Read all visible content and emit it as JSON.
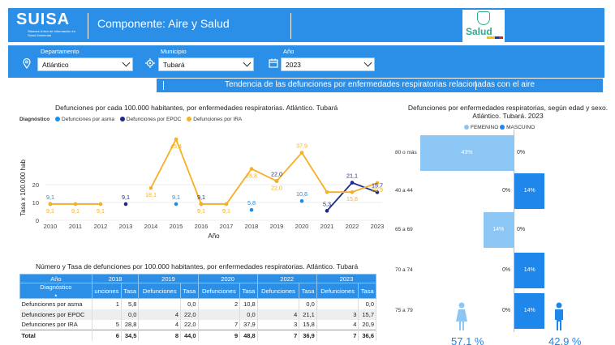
{
  "header": {
    "logo_title": "SUISA",
    "logo_subtitle": "Sistema Unico de Información en Salud Ambiental",
    "component_title": "Componente: Aire y Salud",
    "salud_logo": "Salud"
  },
  "filters": {
    "departamento": {
      "label": "Departamento",
      "value": "Atlántico"
    },
    "municipio": {
      "label": "Municipio",
      "value": "Tubará"
    },
    "anio": {
      "label": "Año",
      "value": "2023"
    }
  },
  "banner": "Tendencia de las defunciones por enfermedades respiratorias relacionadas con el aire",
  "line_chart": {
    "title": "Defunciones por cada 100.000 habitantes, por enfermedades respiratorias. Atlántico. Tubará",
    "legend_title": "Diagnóstico",
    "ylabel": "Tasa x 100.000 hab",
    "xlabel": "Año"
  },
  "chart_data": [
    {
      "type": "line",
      "title": "Defunciones por cada 100.000 habitantes, por enfermedades respiratorias. Atlántico. Tubará",
      "xlabel": "Año",
      "ylabel": "Tasa x 100.000 hab",
      "x": [
        2010,
        2011,
        2012,
        2013,
        2014,
        2015,
        2016,
        2017,
        2018,
        2019,
        2020,
        2021,
        2022,
        2023
      ],
      "ylim": [
        0,
        45.4
      ],
      "yticks": [
        0,
        10,
        20
      ],
      "legend_position": "top-left",
      "series": [
        {
          "name": "Defunciones por asma",
          "color": "#1a8fe8",
          "style": "points",
          "values": [
            9.1,
            null,
            null,
            null,
            null,
            9.1,
            null,
            null,
            5.8,
            null,
            10.8,
            null,
            null,
            null
          ]
        },
        {
          "name": "Defunciones por EPOC",
          "color": "#1c2a8c",
          "style": "line",
          "values": [
            null,
            null,
            null,
            9.1,
            null,
            null,
            9.1,
            null,
            null,
            22.0,
            null,
            5.3,
            21.1,
            15.7
          ]
        },
        {
          "name": "Defunciones por IRA",
          "color": "#f5b023",
          "style": "line",
          "values": [
            9.1,
            9.1,
            9.1,
            null,
            18.1,
            45.4,
            9.1,
            9.1,
            28.8,
            22.0,
            37.9,
            15.8,
            15.8,
            20.9
          ]
        }
      ],
      "labels": [
        {
          "series": 0,
          "i": 0,
          "text": "9,1",
          "above": true
        },
        {
          "series": 2,
          "i": 0,
          "text": "9,1",
          "above": false
        },
        {
          "series": 2,
          "i": 1,
          "text": "9,1",
          "above": false
        },
        {
          "series": 2,
          "i": 2,
          "text": "9,1",
          "above": false
        },
        {
          "series": 1,
          "i": 3,
          "text": "9,1",
          "above": true
        },
        {
          "series": 2,
          "i": 4,
          "text": "18,1",
          "above": false
        },
        {
          "series": 0,
          "i": 5,
          "text": "9,1",
          "above": true
        },
        {
          "series": 2,
          "i": 5,
          "text": "45,4",
          "above": false
        },
        {
          "series": 1,
          "i": 6,
          "text": "9,1",
          "above": true
        },
        {
          "series": 2,
          "i": 6,
          "text": "9,1",
          "above": false
        },
        {
          "series": 2,
          "i": 7,
          "text": "9,1",
          "above": false
        },
        {
          "series": 0,
          "i": 8,
          "text": "5,8",
          "above": true
        },
        {
          "series": 2,
          "i": 8,
          "text": "28,8",
          "above": false
        },
        {
          "series": 1,
          "i": 9,
          "text": "22,0",
          "above": true
        },
        {
          "series": 2,
          "i": 9,
          "text": "22,0",
          "above": false
        },
        {
          "series": 0,
          "i": 10,
          "text": "10,8",
          "above": true
        },
        {
          "series": 2,
          "i": 10,
          "text": "37,9",
          "above": true
        },
        {
          "series": 1,
          "i": 11,
          "text": "5,3",
          "above": true
        },
        {
          "series": 1,
          "i": 12,
          "text": "21,1",
          "above": true
        },
        {
          "series": 2,
          "i": 12,
          "text": "15,8",
          "above": false
        },
        {
          "series": 1,
          "i": 13,
          "text": "15,7",
          "above": true
        },
        {
          "series": 2,
          "i": 13,
          "text": "20,9",
          "above": false
        }
      ]
    },
    {
      "type": "bar",
      "orientation": "horizontal-diverging",
      "title": "Defunciones por enfermedades respiratorias, según edad y sexo. Atlántico. Tubará. 2023",
      "categories": [
        "80 o más",
        "40 a 44",
        "65 a 69",
        "70 a 74",
        "75 a 79"
      ],
      "series": [
        {
          "name": "FEMENINO",
          "color": "#8cc6f5",
          "values": [
            43,
            0,
            14,
            0,
            0
          ],
          "labels": [
            "43%",
            "0%",
            "14%",
            "0%",
            "0%"
          ]
        },
        {
          "name": "MASCUINO",
          "color": "#1f86ec",
          "values": [
            0,
            14,
            0,
            14,
            14
          ],
          "labels": [
            "0%",
            "14%",
            "0%",
            "14%",
            "14%"
          ]
        }
      ],
      "totals": {
        "femenino": "57,1 %",
        "masculino": "42,9 %"
      }
    }
  ],
  "table": {
    "title": "Número y Tasa de defunciones por 100.000 habitantes, por enfermedades respiratorias. Atlántico. Tubará",
    "year_header": "Año",
    "diag_header": "Diagnóstico",
    "years": [
      "2018",
      "2019",
      "2020",
      "2022",
      "2023"
    ],
    "sub_def": "Defunciones",
    "sub_def_cut": "unciones",
    "sub_tasa": "Tasa",
    "rows": [
      {
        "name": "Defunciones por asma",
        "cells": [
          "1",
          "5,8",
          "",
          "0,0",
          "2",
          "10,8",
          "",
          "0,0",
          "",
          "0,0"
        ]
      },
      {
        "name": "Defunciones por EPOC",
        "cells": [
          "",
          "0,0",
          "4",
          "22,0",
          "",
          "0,0",
          "4",
          "21,1",
          "3",
          "15,7"
        ]
      },
      {
        "name": "Defunciones por IRA",
        "cells": [
          "5",
          "28,8",
          "4",
          "22,0",
          "7",
          "37,9",
          "3",
          "15,8",
          "4",
          "20,9"
        ]
      },
      {
        "name": "Total",
        "cells": [
          "6",
          "34,5",
          "8",
          "44,0",
          "9",
          "48,8",
          "7",
          "36,9",
          "7",
          "36,6"
        ]
      }
    ]
  },
  "colors": {
    "brand": "#2b8fe8",
    "asma": "#1a8fe8",
    "epoc": "#1c2a8c",
    "ira": "#f5b023"
  }
}
